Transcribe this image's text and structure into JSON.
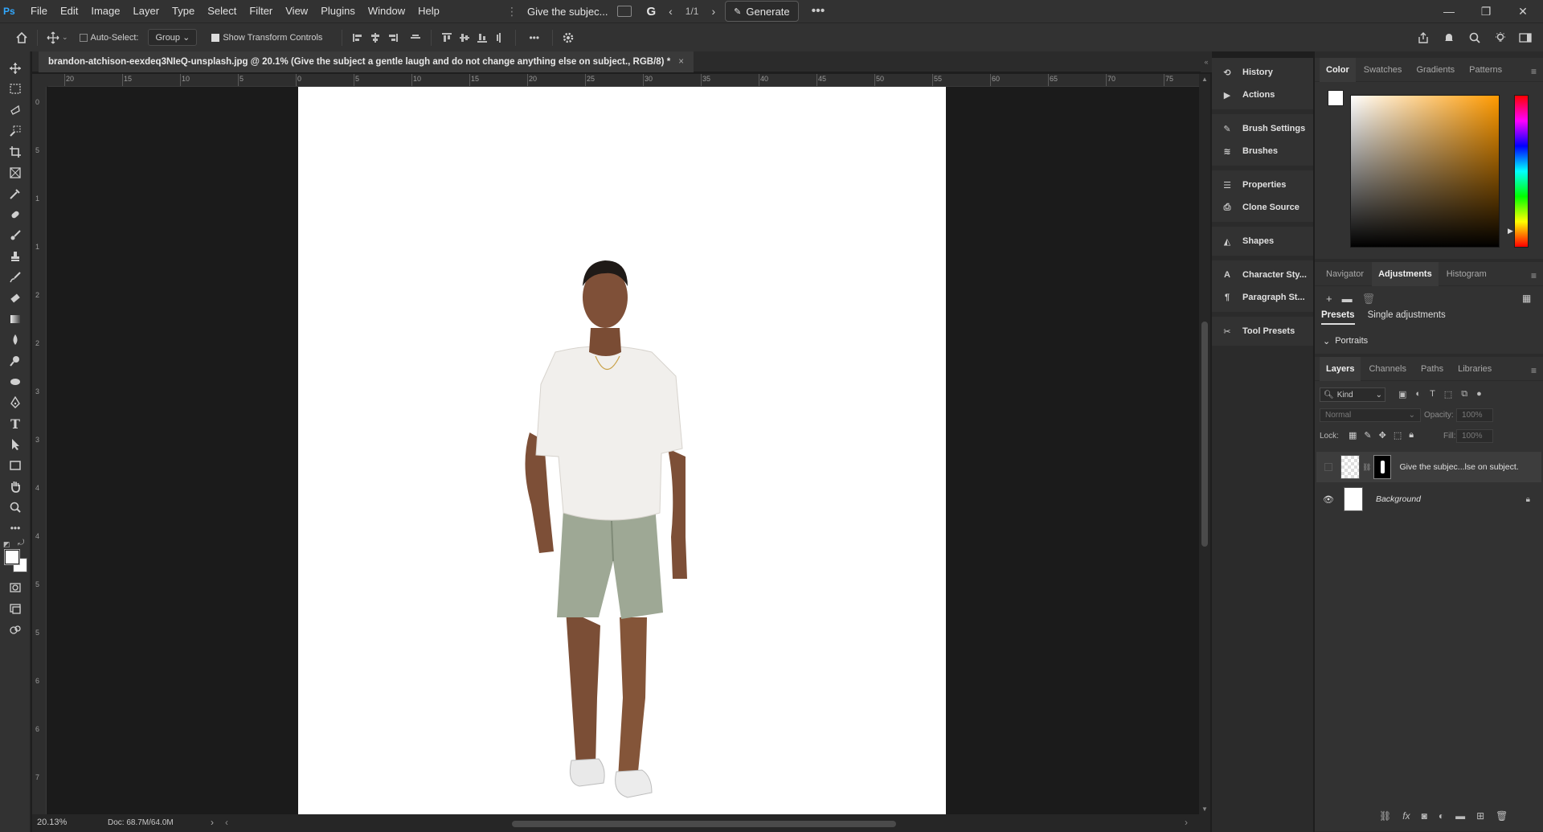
{
  "menubar": {
    "logo": "Ps",
    "items": [
      "File",
      "Edit",
      "Image",
      "Layer",
      "Type",
      "Select",
      "Filter",
      "View",
      "Plugins",
      "Window",
      "Help"
    ],
    "prompt_text": "Give the subjec...",
    "page_counter": "1/1",
    "generate_label": "Generate"
  },
  "optionsbar": {
    "auto_select_label": "Auto-Select:",
    "group_select": "Group",
    "show_transform_label": "Show Transform Controls"
  },
  "document": {
    "tab_title": "brandon-atchison-eexdeq3NIeQ-unsplash.jpg @ 20.1% (Give the subject a gentle laugh and do not change anything else on subject., RGB/8) *",
    "close": "×"
  },
  "rulers": {
    "top": [
      "20",
      "15",
      "10",
      "5",
      "0",
      "5",
      "10",
      "15",
      "20",
      "25",
      "30",
      "35",
      "40",
      "45",
      "50",
      "55",
      "60",
      "65",
      "70",
      "75"
    ],
    "left": [
      "0",
      "5",
      "1",
      "1",
      "2",
      "2",
      "3",
      "3",
      "4",
      "4",
      "5",
      "5",
      "6",
      "6",
      "7"
    ]
  },
  "status": {
    "zoom": "20.13%",
    "doc_info": "Doc: 68.7M/64.0M"
  },
  "dock": {
    "items": [
      "History",
      "Actions",
      "Brush Settings",
      "Brushes",
      "Properties",
      "Clone Source",
      "Shapes",
      "Character Sty...",
      "Paragraph St...",
      "Tool Presets"
    ]
  },
  "color_panel": {
    "tabs": [
      "Color",
      "Swatches",
      "Gradients",
      "Patterns"
    ],
    "active": "Color"
  },
  "adjustments_panel": {
    "tabs": [
      "Navigator",
      "Adjustments",
      "Histogram"
    ],
    "active": "Adjustments",
    "subtabs": [
      "Presets",
      "Single adjustments"
    ],
    "group": "Portraits"
  },
  "layers_panel": {
    "tabs": [
      "Layers",
      "Channels",
      "Paths",
      "Libraries"
    ],
    "active": "Layers",
    "filter_kind": "Kind",
    "blend_mode": "Normal",
    "opacity_label": "Opacity:",
    "opacity_value": "100%",
    "lock_label": "Lock:",
    "fill_label": "Fill:",
    "fill_value": "100%",
    "layers": [
      {
        "name": "Give the subjec...lse on subject.",
        "visible": false,
        "selected": true
      },
      {
        "name": "Background",
        "visible": true,
        "selected": false,
        "locked": true
      }
    ]
  },
  "colors": {
    "accent": "#31a8ff",
    "panel_bg": "#323232",
    "canvas_bg": "#1b1b1b",
    "shirt": "#f1efec",
    "shorts": "#9ea895",
    "skin": "#8a5a3f"
  }
}
